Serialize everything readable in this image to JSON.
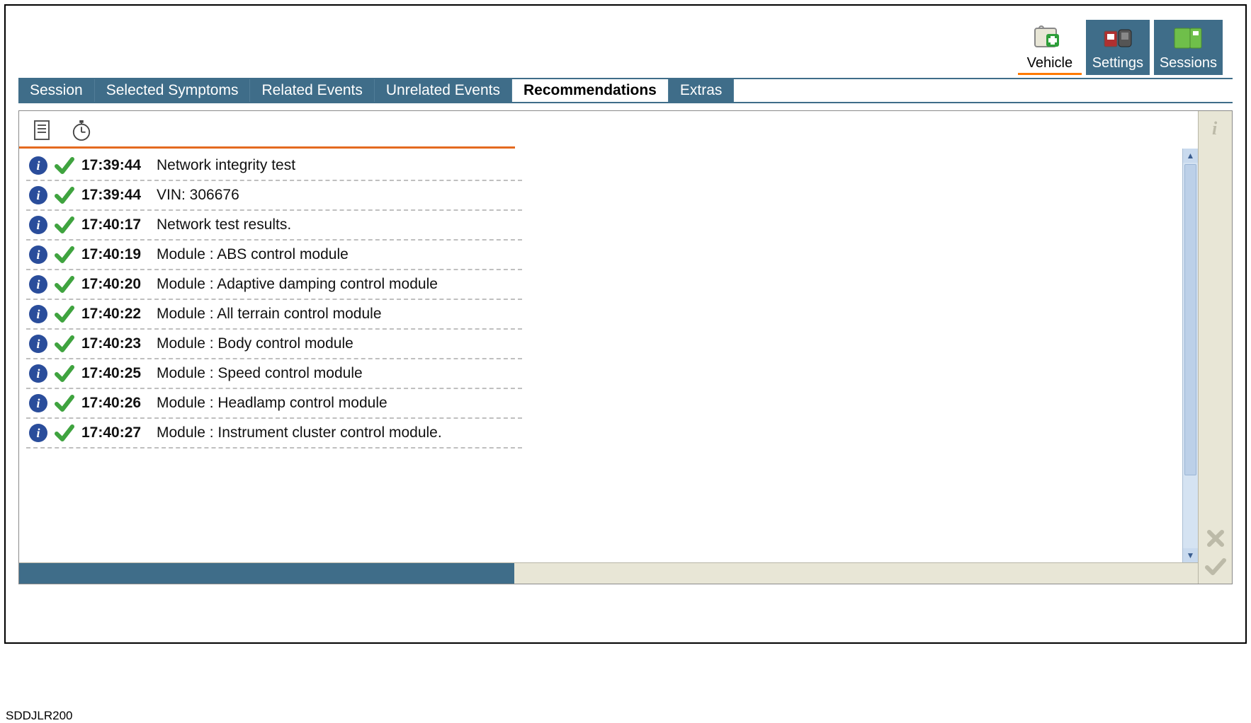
{
  "refcode": "SDDJLR200",
  "module_tabs": [
    {
      "id": "vehicle",
      "label": "Vehicle",
      "active": true
    },
    {
      "id": "settings",
      "label": "Settings",
      "active": false
    },
    {
      "id": "sessions",
      "label": "Sessions",
      "active": false
    }
  ],
  "tabs": [
    {
      "id": "session",
      "label": "Session",
      "active": false
    },
    {
      "id": "selected-symptoms",
      "label": "Selected Symptoms",
      "active": false
    },
    {
      "id": "related-events",
      "label": "Related Events",
      "active": false
    },
    {
      "id": "unrelated-events",
      "label": "Unrelated Events",
      "active": false
    },
    {
      "id": "recommendations",
      "label": "Recommendations",
      "active": true
    },
    {
      "id": "extras",
      "label": "Extras",
      "active": false
    }
  ],
  "log_rows": [
    {
      "time": "17:39:44",
      "desc": "Network integrity test"
    },
    {
      "time": "17:39:44",
      "desc": "VIN: 306676"
    },
    {
      "time": "17:40:17",
      "desc": "Network test results."
    },
    {
      "time": "17:40:19",
      "desc": "Module : ABS control module"
    },
    {
      "time": "17:40:20",
      "desc": "Module : Adaptive damping control module"
    },
    {
      "time": "17:40:22",
      "desc": "Module : All terrain control module"
    },
    {
      "time": "17:40:23",
      "desc": "Module : Body control module"
    },
    {
      "time": "17:40:25",
      "desc": "Module : Speed control module"
    },
    {
      "time": "17:40:26",
      "desc": "Module : Headlamp control module"
    },
    {
      "time": "17:40:27",
      "desc": "Module : Instrument cluster control module."
    }
  ],
  "progress_percent": 42,
  "colors": {
    "brand_blue": "#3f6d89",
    "accent_orange": "#e46a1f",
    "panel_bg": "#e8e6d6",
    "info_badge": "#2a4d9b",
    "check_green": "#3fa33f"
  }
}
